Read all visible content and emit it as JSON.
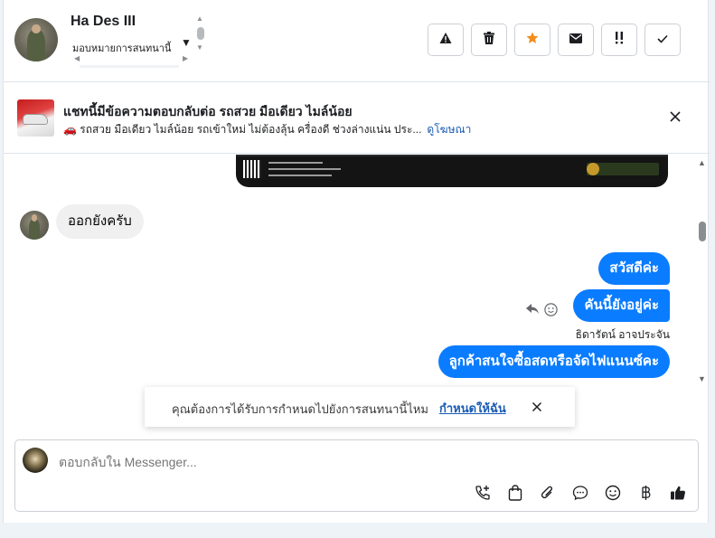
{
  "header": {
    "name": "Ha Des III",
    "subtitle": "มอบหมายการสนทนานี้",
    "tools": [
      {
        "name": "report-button",
        "icon": "warning-icon"
      },
      {
        "name": "delete-button",
        "icon": "trash-icon"
      },
      {
        "name": "star-button",
        "icon": "star-icon"
      },
      {
        "name": "mail-button",
        "icon": "mail-icon"
      },
      {
        "name": "follow-up-button",
        "icon": "double-exclamation-icon"
      },
      {
        "name": "done-button",
        "icon": "check-icon"
      }
    ]
  },
  "ad": {
    "title": "แชทนี้มีข้อความตอบกลับต่อ รถสวย มือเดียว ไมล์น้อย",
    "description": "🚗 รถสวย มือเดียว ไมล์น้อย รถเข้าใหม่ ไม่ต้องลุ้น ครื่องดี ช่วงล่างแน่น ประ...",
    "link": "ดูโฆษณา"
  },
  "messages": {
    "incoming": "ออกยังครับ",
    "outgoing": [
      "สวัสดีค่ะ",
      "คันนี้ยังอยู่ค่ะ",
      "ลูกค้าสนใจซื้อสดหรือจัดไฟแนนซ์คะ"
    ],
    "sender_name": "ธิดารัตน์ อาจประจัน"
  },
  "toast": {
    "text": "คุณต้องการได้รับการกำหนดไปยังการสนทนานี้ไหม",
    "link": "กำหนดให้ฉัน"
  },
  "composer": {
    "placeholder": "ตอบกลับใน Messenger...",
    "tools": [
      "call-add-icon",
      "shopping-bag-icon",
      "paperclip-icon",
      "chat-bubble-icon",
      "emoji-icon",
      "baht-icon",
      "thumbs-up-icon"
    ]
  },
  "colors": {
    "accent": "#0a7cff",
    "link": "#1a5bb5",
    "star": "#f28d1b"
  }
}
